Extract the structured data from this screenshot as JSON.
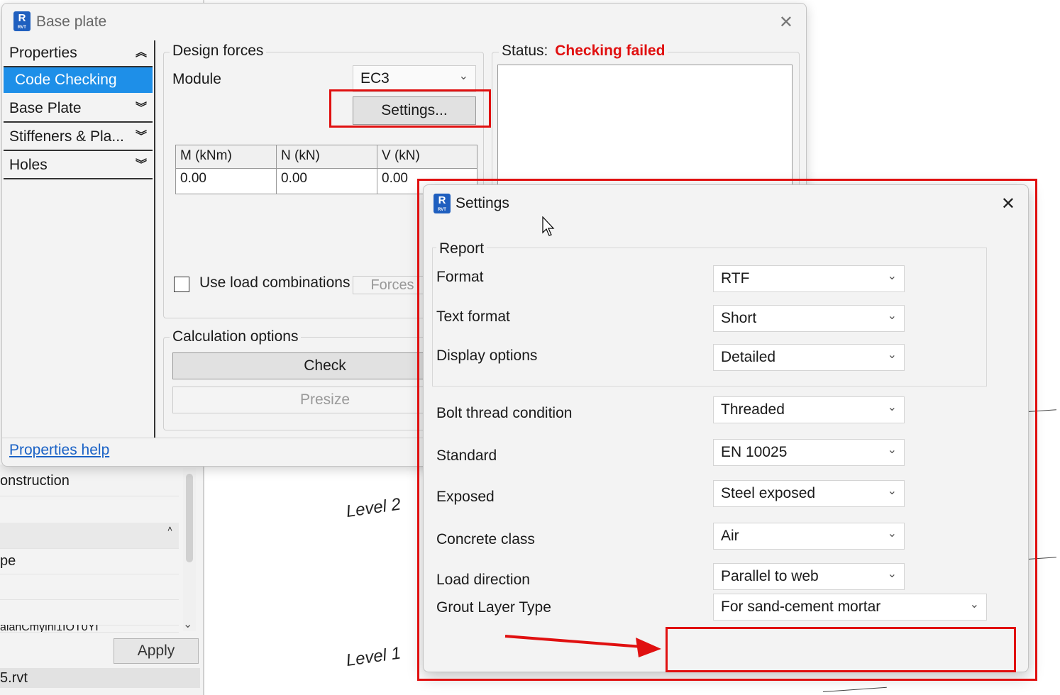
{
  "background": {
    "rows": [
      "onstruction",
      "",
      "",
      "pe",
      "",
      "",
      "alanCmylhi1IOT0YI"
    ],
    "apply_label": "Apply",
    "file_label": "5.rvt",
    "level2": "Level 2",
    "level1": "Level 1"
  },
  "base_plate": {
    "title": "Base plate",
    "icon_letter": "R",
    "icon_sub": "RVT",
    "sidebar": [
      {
        "label": "Properties",
        "chevron": "up"
      },
      {
        "label": "Code Checking",
        "chevron": "none",
        "active": true
      },
      {
        "label": "Base Plate",
        "chevron": "down"
      },
      {
        "label": "Stiffeners & Pla...",
        "chevron": "down"
      },
      {
        "label": "Holes",
        "chevron": "down"
      }
    ],
    "design_forces": {
      "group_label": "Design forces",
      "module_label": "Module",
      "module_value": "EC3",
      "settings_button": "Settings...",
      "table": {
        "headers": [
          "M (kNm)",
          "N (kN)",
          "V (kN)"
        ],
        "values": [
          "0.00",
          "0.00",
          "0.00"
        ]
      },
      "use_load_combinations": "Use load combinations",
      "forces_button": "Forces"
    },
    "status": {
      "label": "Status:",
      "value": "Checking failed",
      "value_color": "#e01010"
    },
    "calculation_options": {
      "group_label": "Calculation options",
      "check_button": "Check",
      "presize_button": "Presize"
    },
    "help_link": "Properties help"
  },
  "settings": {
    "title": "Settings",
    "icon_letter": "R",
    "icon_sub": "RVT",
    "report_group": "Report",
    "rows": [
      {
        "label": "Format",
        "value": "RTF"
      },
      {
        "label": "Text format",
        "value": "Short"
      },
      {
        "label": "Display options",
        "value": "Detailed"
      },
      {
        "label": "Bolt thread condition",
        "value": "Threaded"
      },
      {
        "label": "Standard",
        "value": "EN 10025"
      },
      {
        "label": "Exposed",
        "value": "Steel exposed"
      },
      {
        "label": "Concrete class",
        "value": "Air"
      },
      {
        "label": "Load direction",
        "value": "Parallel to web"
      },
      {
        "label": "Grout Layer Type",
        "value": "For sand-cement mortar"
      }
    ]
  },
  "annotation_color": "#e01010"
}
